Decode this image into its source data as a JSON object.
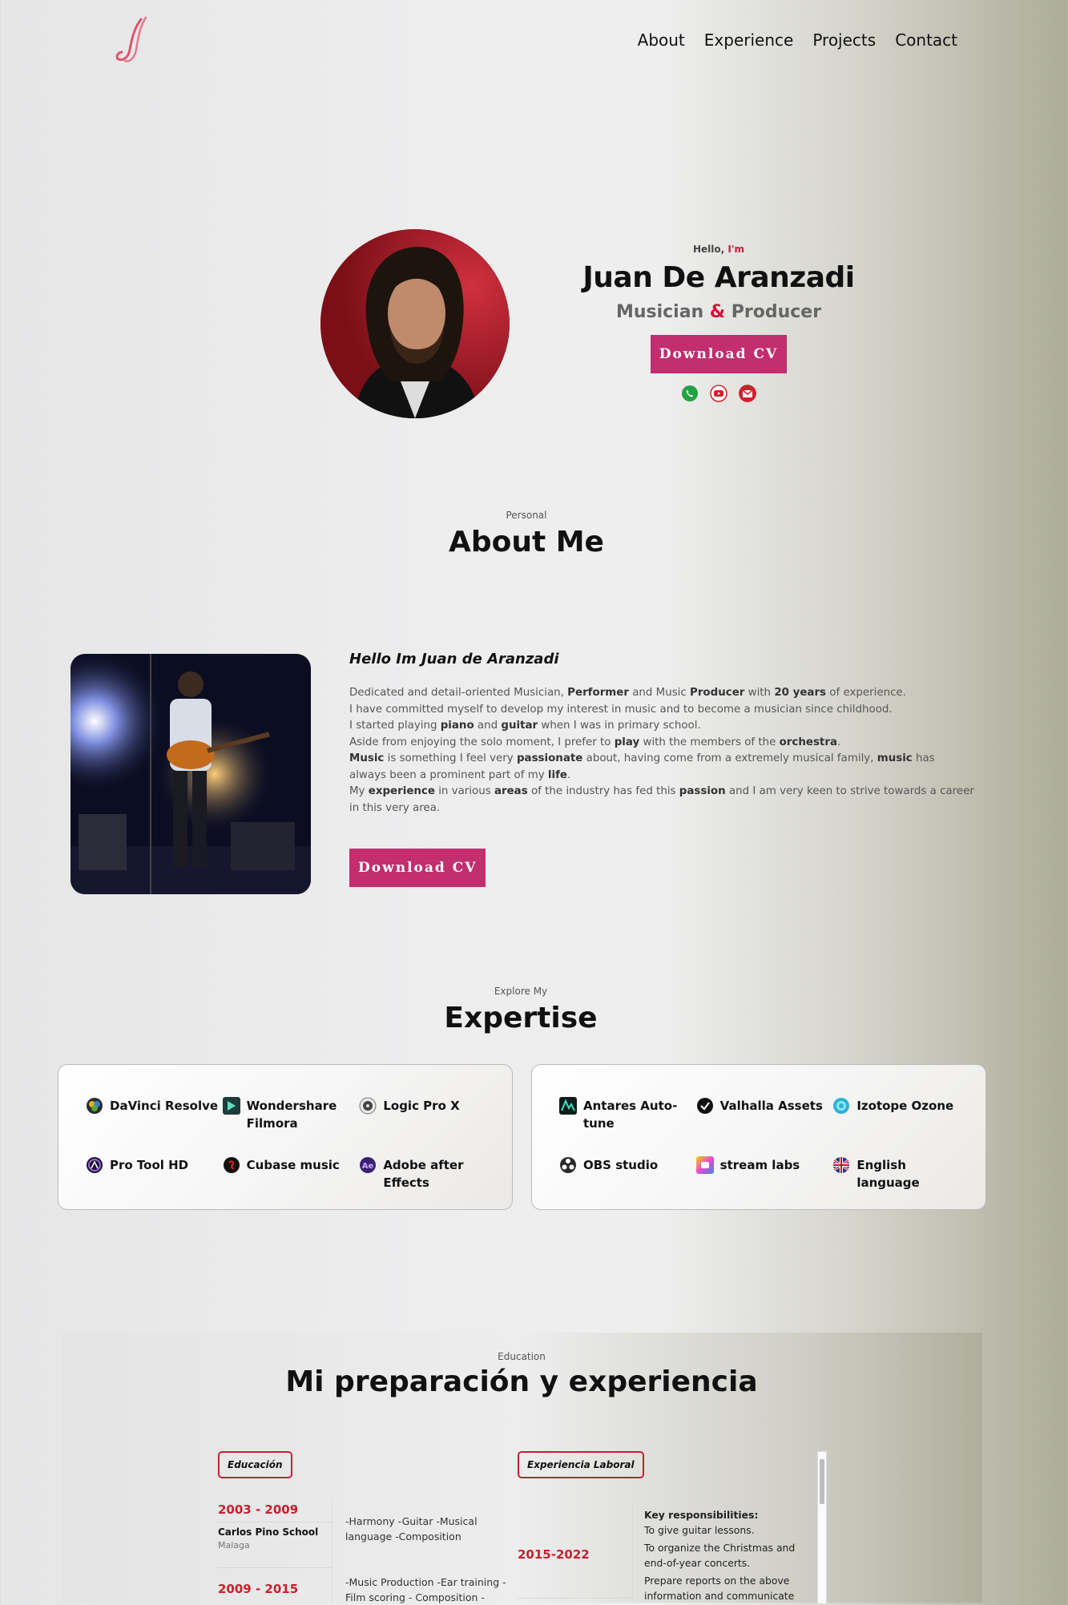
{
  "nav": {
    "logo_alt": "JJ logo",
    "links": [
      "About",
      "Experience",
      "Projects",
      "Contact"
    ]
  },
  "hero": {
    "hello": "Hello,",
    "im": "I'm",
    "name": "Juan De Aranzadi",
    "role_a": "Musician",
    "role_amp": "&",
    "role_b": "Producer",
    "cv_label": "Download CV",
    "socials": [
      "whatsapp-icon",
      "youtube-icon",
      "gmail-icon"
    ]
  },
  "about": {
    "sub": "Personal",
    "title": "About Me",
    "hello": "Hello Im Juan de Aranzadi",
    "p": {
      "a1": "Dedicated and detail-oriented Musician, ",
      "b1": "Performer",
      "a2": " and Music ",
      "b2": "Producer",
      "a3": " with ",
      "b3": "20 years",
      "a4": " of experience.",
      "a5": "I have committed myself to develop my interest in music and to become a musician since childhood.",
      "a6": "I started playing ",
      "b4": "piano",
      "a7": " and ",
      "b5": "guitar",
      "a8": " when I was in primary school.",
      "a9": "Aside from enjoying the solo moment, I prefer to ",
      "b6": "play",
      "a10": " with the members of the ",
      "b7": "orchestra",
      "a11": ".",
      "b8": "Music",
      "a12": " is something I feel very ",
      "b9": "passionate",
      "a13": " about, having come from a extremely musical family, ",
      "b10": "music",
      "a14": " has always been a prominent part of my ",
      "b11": "life",
      "a15": ".",
      "a16": "My ",
      "b12": "experience",
      "a17": " in various ",
      "b13": "areas",
      "a18": " of the industry has fed this ",
      "b14": "passion",
      "a19": " and I am very keen to strive towards a career in this very area."
    },
    "cv_label": "Download CV"
  },
  "expertise": {
    "sub": "Explore My",
    "title": "Expertise",
    "cards": [
      {
        "skills": [
          {
            "name": "DaVinci Resolve",
            "icon": "davinci-icon",
            "color": "#3d5f8a"
          },
          {
            "name": "Wondershare Filmora",
            "icon": "filmora-icon",
            "color": "#1e3d3a"
          },
          {
            "name": "Logic Pro X",
            "icon": "logic-pro-icon",
            "color": "#777777"
          },
          {
            "name": "Pro Tool HD",
            "icon": "pro-tools-icon",
            "color": "#5c2a8a"
          },
          {
            "name": "Cubase music",
            "icon": "cubase-icon",
            "color": "#b01020"
          },
          {
            "name": "Adobe after Effects",
            "icon": "after-effects-icon",
            "color": "#4a2d80"
          }
        ]
      },
      {
        "skills": [
          {
            "name": "Antares Auto-tune",
            "icon": "antares-icon",
            "color": "#0e3e3a"
          },
          {
            "name": "Valhalla Assets",
            "icon": "valhalla-icon",
            "color": "#111111"
          },
          {
            "name": "Izotope Ozone",
            "icon": "izotope-icon",
            "color": "#2ab3d6"
          },
          {
            "name": "OBS studio",
            "icon": "obs-icon",
            "color": "#333333"
          },
          {
            "name": "stream labs",
            "icon": "streamlabs-icon",
            "color": "#d94fd6"
          },
          {
            "name": "English language",
            "icon": "uk-flag-icon",
            "color": "#c8102e"
          }
        ]
      }
    ]
  },
  "education": {
    "sub": "Education",
    "title": "Mi preparación y experiencia",
    "tag_edu": "Educación",
    "tag_work": "Experiencia Laboral",
    "items": [
      {
        "years": "2003 - 2009",
        "school": "Carlos Pino School",
        "place": "Malaga",
        "desc": "-Harmony -Guitar -Musical language -Composition"
      },
      {
        "years": "2009 - 2015",
        "desc": "-Music Production -Ear training - Film scoring - Composition -"
      }
    ],
    "work": {
      "years": "2015-2022",
      "heading": "Key responsibilities:",
      "lines": [
        "To give guitar lessons.",
        "To organize the Christmas and end-of-year concerts.",
        "Prepare reports on the above information and communicate"
      ]
    }
  },
  "colors": {
    "accent": "#c8202e",
    "button": "#c22e6e"
  }
}
